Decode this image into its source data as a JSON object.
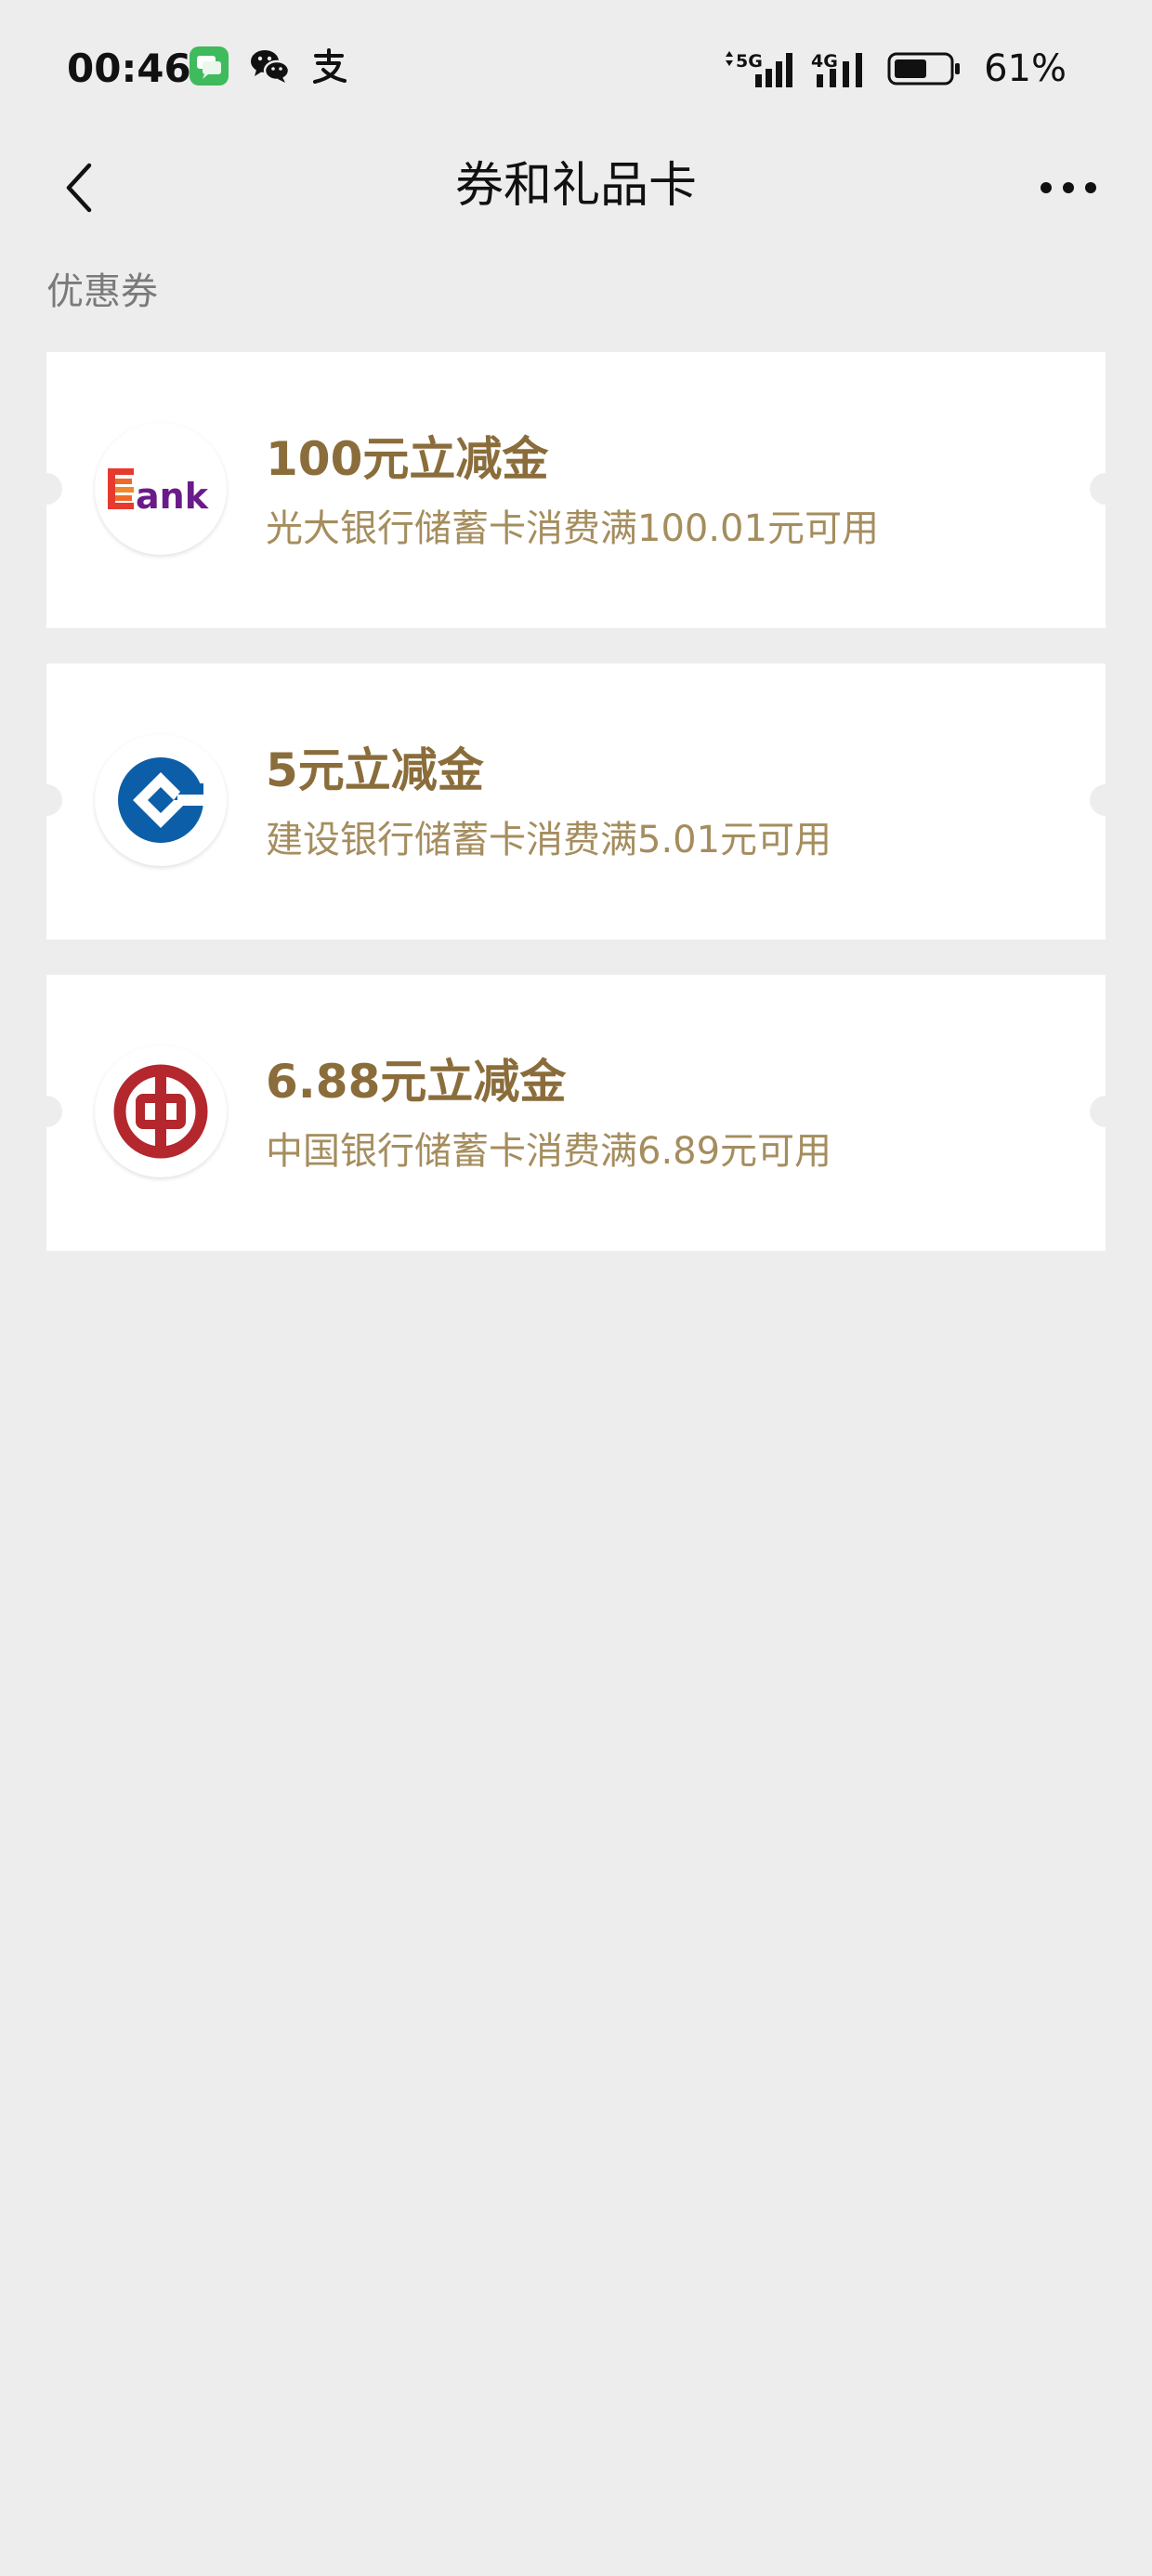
{
  "status_bar": {
    "time": "00:46",
    "network_1": "5G",
    "network_2": "4G",
    "battery_percent_text": "61%",
    "battery_level": 0.61,
    "app_icons": [
      "messages-icon",
      "wechat-icon",
      "alipay-icon"
    ]
  },
  "nav": {
    "title": "券和礼品卡"
  },
  "section": {
    "title": "优惠券"
  },
  "coupons": [
    {
      "name": "100元立减金",
      "condition": "光大银行储蓄卡消费满100.01元可用",
      "logo": "ceb-bank-logo",
      "logo_text": "ank"
    },
    {
      "name": "5元立减金",
      "condition": "建设银行储蓄卡消费满5.01元可用",
      "logo": "ccb-bank-logo"
    },
    {
      "name": "6.88元立减金",
      "condition": "中国银行储蓄卡消费满6.89元可用",
      "logo": "boc-bank-logo"
    }
  ],
  "colors": {
    "background": "#ededed",
    "card": "#ffffff",
    "coupon_title": "#8a6d3b",
    "coupon_subtitle": "#a58d5e",
    "ceb_purple": "#6a1b8a",
    "ceb_red": "#e63a2e",
    "ccb_blue": "#0d5ea8",
    "boc_red": "#b3272d"
  }
}
